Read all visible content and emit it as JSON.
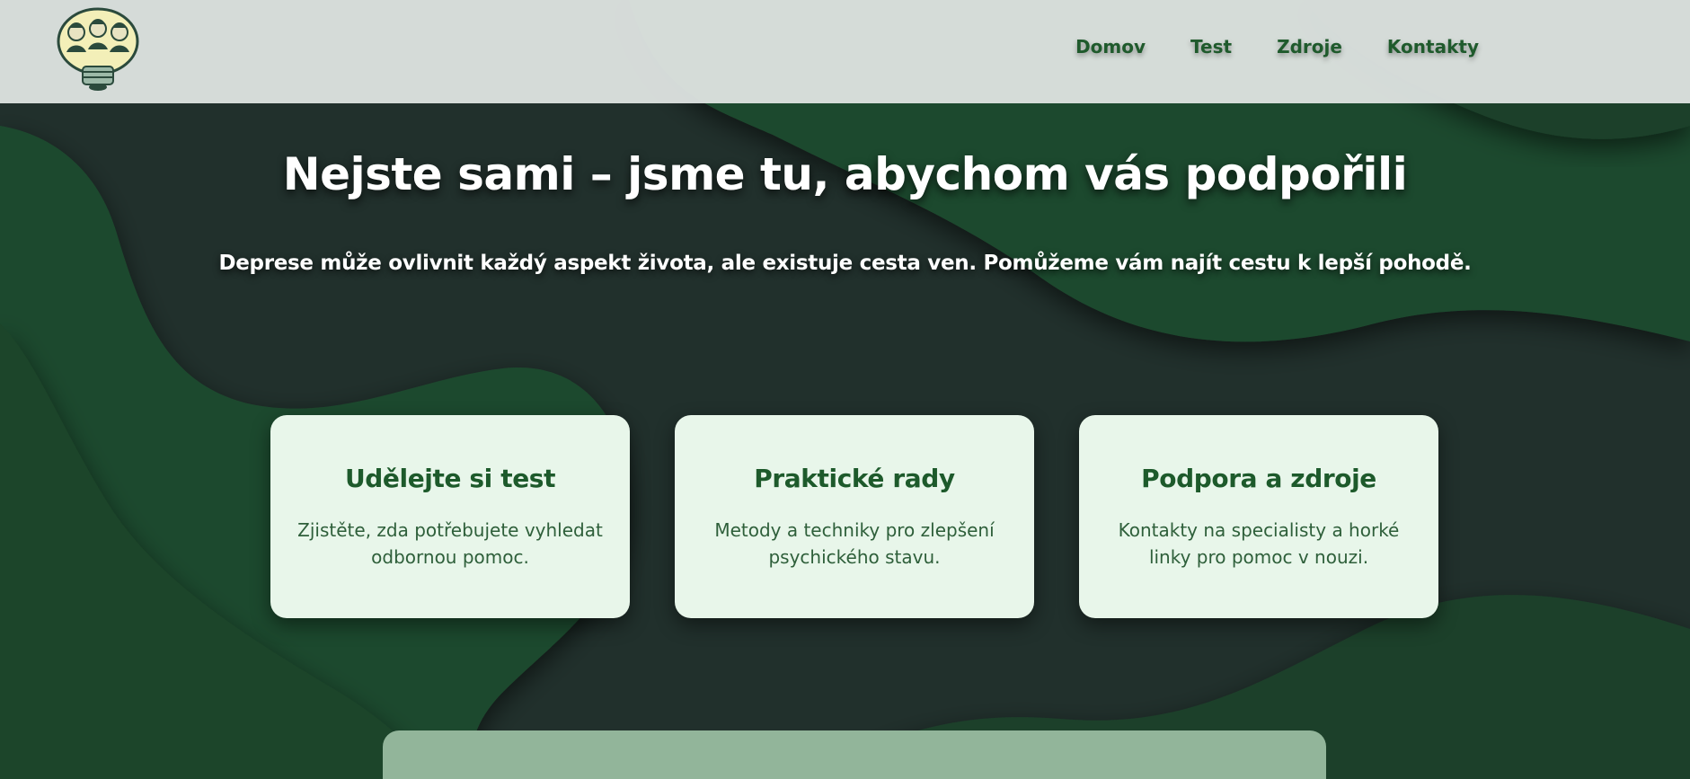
{
  "nav": {
    "items": [
      "Domov",
      "Test",
      "Zdroje",
      "Kontakty"
    ]
  },
  "hero": {
    "title": "Nejste sami – jsme tu, abychom vás podpořili",
    "subtitle": "Deprese může ovlivnit každý aspekt života, ale existuje cesta ven. Pomůžeme vám najít cestu k lepší pohodě."
  },
  "cards": [
    {
      "title": "Udělejte si test",
      "text": "Zjistěte, zda potřebujete vyhledat odbornou pomoc."
    },
    {
      "title": "Praktické rady",
      "text": "Metody a techniky pro zlepšení psychického stavu."
    },
    {
      "title": "Podpora a zdroje",
      "text": "Kontakty na specialisty a horké linky pro pomoc v nouzi."
    }
  ],
  "colors": {
    "accent": "#1d5a2b",
    "card_bg": "#e8f6ea",
    "dark_bg": "#20302b",
    "wave_green": "#1e4a2e",
    "header_bg": "#dde2e0",
    "bottom_panel": "#92b59a"
  },
  "icons": {
    "logo": "lightbulb-people-logo"
  }
}
